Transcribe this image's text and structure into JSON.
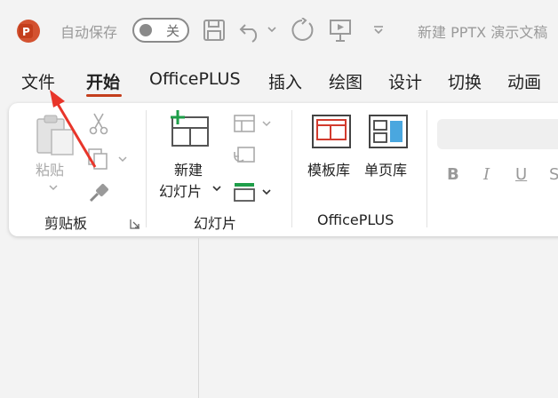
{
  "titlebar": {
    "autosave_label": "自动保存",
    "autosave_state": "关",
    "doc_title": "新建 PPTX 演示文稿"
  },
  "tabs": [
    {
      "label": "文件"
    },
    {
      "label": "开始"
    },
    {
      "label": "OfficePLUS"
    },
    {
      "label": "插入"
    },
    {
      "label": "绘图"
    },
    {
      "label": "设计"
    },
    {
      "label": "切换"
    },
    {
      "label": "动画"
    }
  ],
  "ribbon": {
    "clipboard": {
      "paste": "粘贴",
      "group": "剪贴板"
    },
    "slides": {
      "new_line1": "新建",
      "new_line2": "幻灯片",
      "group": "幻灯片"
    },
    "officeplus": {
      "template_lib": "模板库",
      "single_page_lib": "单页库",
      "group": "OfficePLUS"
    },
    "font": {
      "bold": "B",
      "italic": "I",
      "underline": "U",
      "strike": "S"
    }
  },
  "colors": {
    "accent": "#c43e1c",
    "arrow": "#e8352a"
  }
}
